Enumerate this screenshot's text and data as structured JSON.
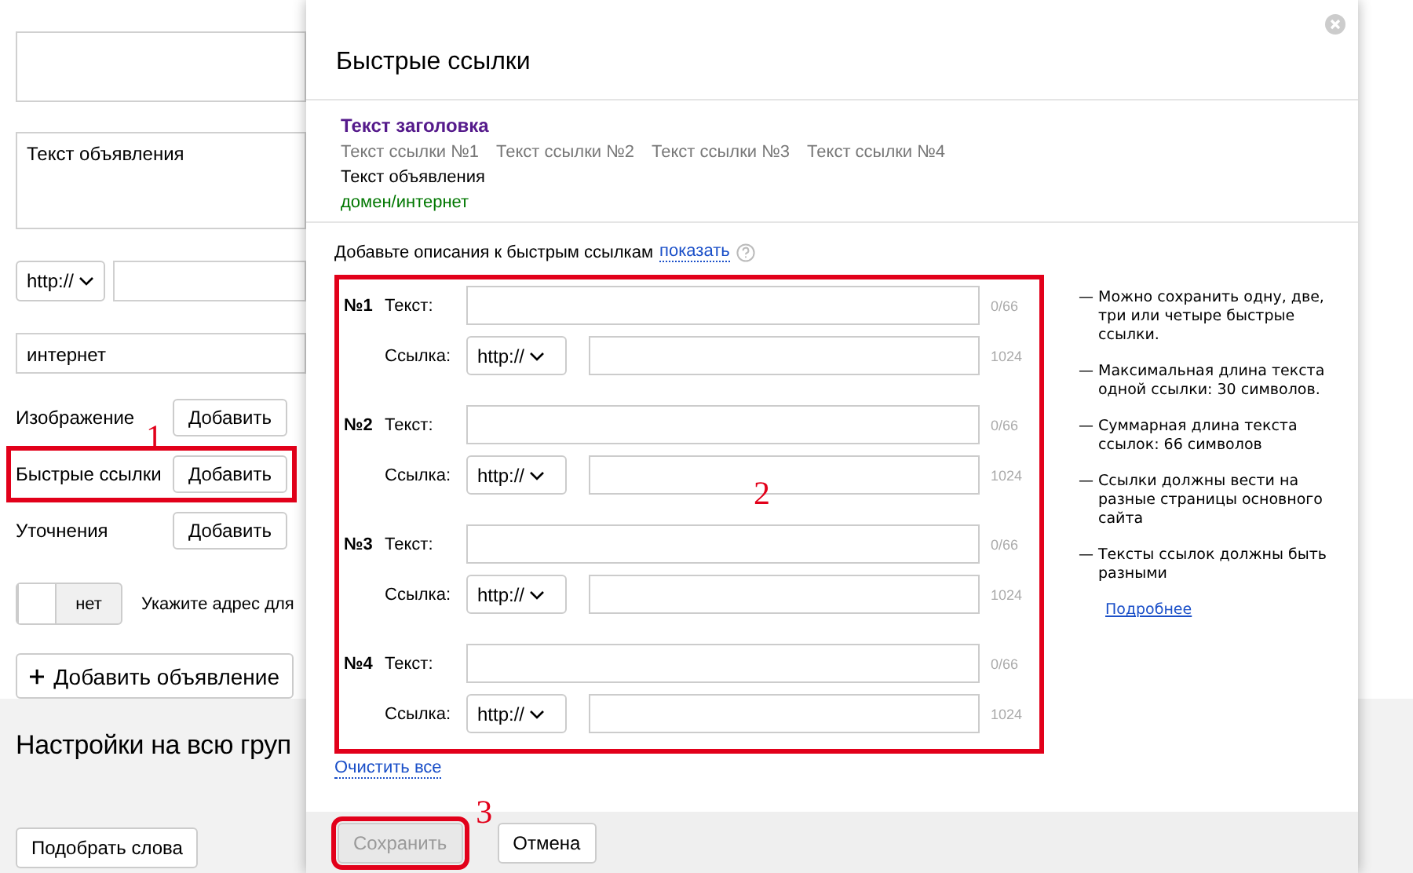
{
  "ad_form": {
    "ad_text": "Текст объявления",
    "protocol": "http://",
    "display_path": "интернет",
    "extensions": [
      {
        "label": "Изображение",
        "button": "Добавить"
      },
      {
        "label": "Быстрые ссылки",
        "button": "Добавить",
        "highlighted": true,
        "annotation": "1"
      },
      {
        "label": "Уточнения",
        "button": "Добавить"
      }
    ],
    "toggle": {
      "label": "нет",
      "on": false
    },
    "toggle_hint": "Укажите адрес для",
    "add_ad_button": "Добавить объявление"
  },
  "group_settings": {
    "title": "Настройки на всю груп",
    "button": "Подобрать слова"
  },
  "dialog": {
    "title": "Быстрые ссылки",
    "preview": {
      "headline": "Текст заголовка",
      "links": [
        "Текст ссылки №1",
        "Текст ссылки №2",
        "Текст ссылки №3",
        "Текст ссылки №4"
      ],
      "text": "Текст объявления",
      "domain": "домен/интернет"
    },
    "descriptions_prompt": "Добавьте описания к быстрым ссылкам",
    "show_link": "показать",
    "sitelinks_highlighted": true,
    "sitelinks_annotation": "2",
    "sitelinks": [
      {
        "number": "№1",
        "text_label": "Текст:",
        "counter": "0/66",
        "link_label": "Ссылка:",
        "protocol": "http://",
        "link_limit": "1024"
      },
      {
        "number": "№2",
        "text_label": "Текст:",
        "counter": "0/66",
        "link_label": "Ссылка:",
        "protocol": "http://",
        "link_limit": "1024"
      },
      {
        "number": "№3",
        "text_label": "Текст:",
        "counter": "0/66",
        "link_label": "Ссылка:",
        "protocol": "http://",
        "link_limit": "1024"
      },
      {
        "number": "№4",
        "text_label": "Текст:",
        "counter": "0/66",
        "link_label": "Ссылка:",
        "protocol": "http://",
        "link_limit": "1024"
      }
    ],
    "clear_all": "Очистить все",
    "notes": [
      {
        "bullet": "—",
        "text": "Можно сохранить одну, две, три или четыре быстрые ссылки."
      },
      {
        "bullet": "—",
        "text": "Максимальная длина текста одной ссылки: 30 символов."
      },
      {
        "bullet": "—",
        "text": "Суммарная длина текста ссылок: 66 символов"
      },
      {
        "bullet": "—",
        "text": "Ссылки должны вести на разные страницы основного сайта"
      },
      {
        "bullet": "—",
        "text": "Тексты ссылок должны быть разными"
      }
    ],
    "more_link": "Подробнее",
    "buttons": [
      {
        "label": "Сохранить",
        "disabled": true,
        "highlighted": true,
        "annotation": "3"
      },
      {
        "label": "Отмена",
        "disabled": false,
        "highlighted": false
      }
    ]
  }
}
